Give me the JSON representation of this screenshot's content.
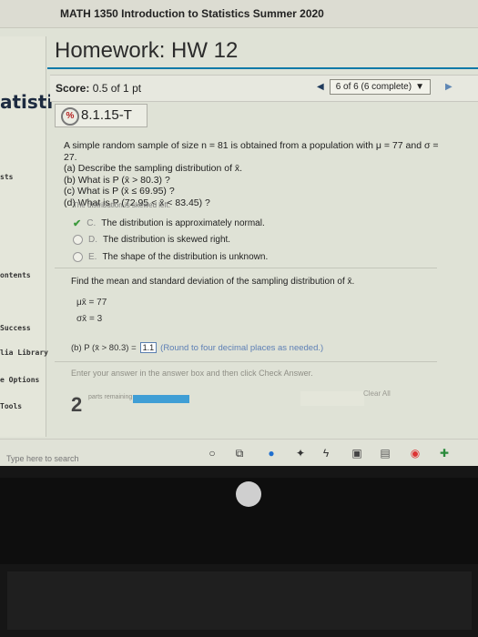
{
  "course": {
    "title": "MATH 1350 Introduction to Statistics Summer 2020"
  },
  "sidebar": {
    "big_text": "atisti",
    "items": [
      {
        "label": "sts",
        "icon": ""
      },
      {
        "label": "ontents",
        "icon": ""
      },
      {
        "label": "Success",
        "icon": ""
      },
      {
        "label": "lia Library",
        "icon": ""
      },
      {
        "label": "e Options",
        "icon": ""
      },
      {
        "label": "Tools",
        "icon": ""
      }
    ]
  },
  "homework": {
    "title": "Homework: HW 12"
  },
  "score": {
    "label": "Score:",
    "value": "0.5 of 1 pt"
  },
  "navigation": {
    "prev_icon": "triangle-left",
    "progress": "6 of 6 (6 complete)",
    "dropdown_icon": "triangle-down",
    "next_icon": "triangle-right"
  },
  "question": {
    "id": "8.1.15-T",
    "status_icon": "partial-credit-icon",
    "status_glyph": "%",
    "intro": "A simple random sample of size n = 81 is obtained from a population with μ = 77 and σ = 27.",
    "parts": [
      "(a) Describe the sampling distribution of x̄.",
      "(b) What is P (x̄ > 80.3) ?",
      "(c) What is P (x̄ ≤ 69.95) ?",
      "(d) What is P (72.95 < x̄ < 83.45) ?"
    ],
    "partial_hidden": "The distribution is skewed left.",
    "options": [
      {
        "letter": "C.",
        "text": "The distribution is approximately normal.",
        "selected": true
      },
      {
        "letter": "D.",
        "text": "The distribution is skewed right.",
        "selected": false
      },
      {
        "letter": "E.",
        "text": "The shape of the distribution is unknown.",
        "selected": false
      }
    ],
    "find_prompt": "Find the mean and standard deviation of the sampling distribution of x̄.",
    "mean_result": "μx̄ = 77",
    "sd_result": "σx̄ = 3",
    "part_b_label": "(b) P (x̄ > 80.3) =",
    "part_b_value": "1.1",
    "part_b_hint": "(Round to four decimal places as needed.)",
    "instruction": "Enter your answer in the answer box and then click Check Answer.",
    "parts_remaining_count": "2",
    "parts_remaining_label": "parts remaining",
    "parts_remaining_fraction": 0.5,
    "clear_all": "Clear All"
  },
  "taskbar": {
    "search_placeholder": "Type here to search",
    "icons": [
      "cortana-circle-icon",
      "task-view-icon",
      "edge-icon",
      "tools-icon",
      "lightning-icon",
      "store-icon",
      "photos-icon",
      "chrome-icon",
      "app-icon"
    ]
  },
  "device": {
    "logo": "hp"
  },
  "colors": {
    "accent": "#0f7aa8",
    "progress": "#3f9ed5",
    "check": "#3d9a3d",
    "hint": "#5d7fb5"
  }
}
